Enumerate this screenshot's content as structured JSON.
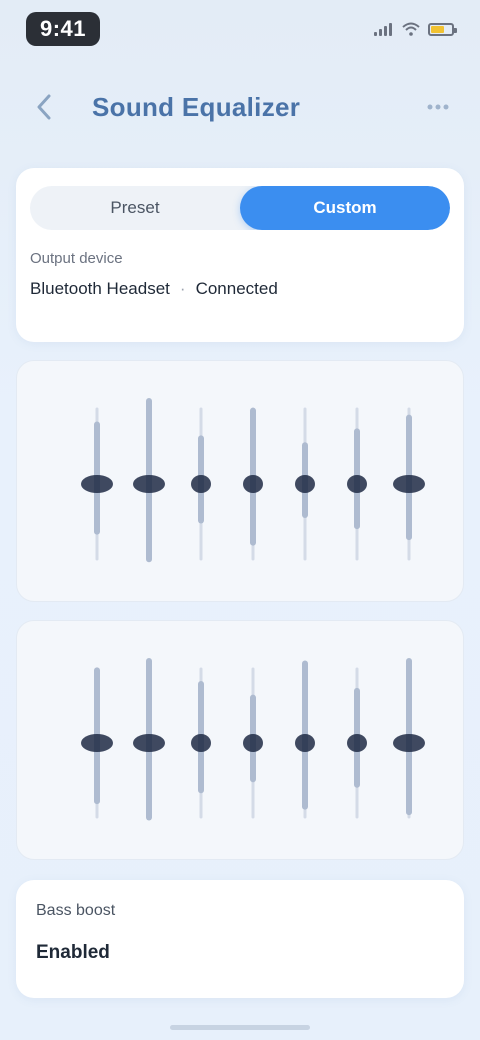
{
  "status_bar": {
    "time": "9:41"
  },
  "header": {
    "title": "Sound Equalizer",
    "back_icon": "chevron-left-icon",
    "action_icon": "more-icon"
  },
  "mode_selector": {
    "options": [
      "Preset",
      "Custom"
    ],
    "selected_index": 1
  },
  "device_info": {
    "label": "Output device",
    "name": "Bluetooth Headset",
    "detail": "Connected"
  },
  "chart_data": [
    {
      "type": "line",
      "series": [
        {
          "values": [
            0.3,
            0.55,
            0.2,
            0.4,
            0.15,
            0.25,
            0.35
          ]
        }
      ]
    },
    {
      "type": "line",
      "series": [
        {
          "values": [
            0.4,
            0.55,
            0.3,
            0.2,
            0.45,
            0.25,
            0.5
          ]
        }
      ]
    }
  ],
  "bottom_card": {
    "label": "Bass boost",
    "value": "Enabled"
  },
  "colors": {
    "accent": "#3b8ef0",
    "title": "#4a73a8",
    "slider_dark": "#1e2a44",
    "slider_light": "#aebbd0"
  }
}
